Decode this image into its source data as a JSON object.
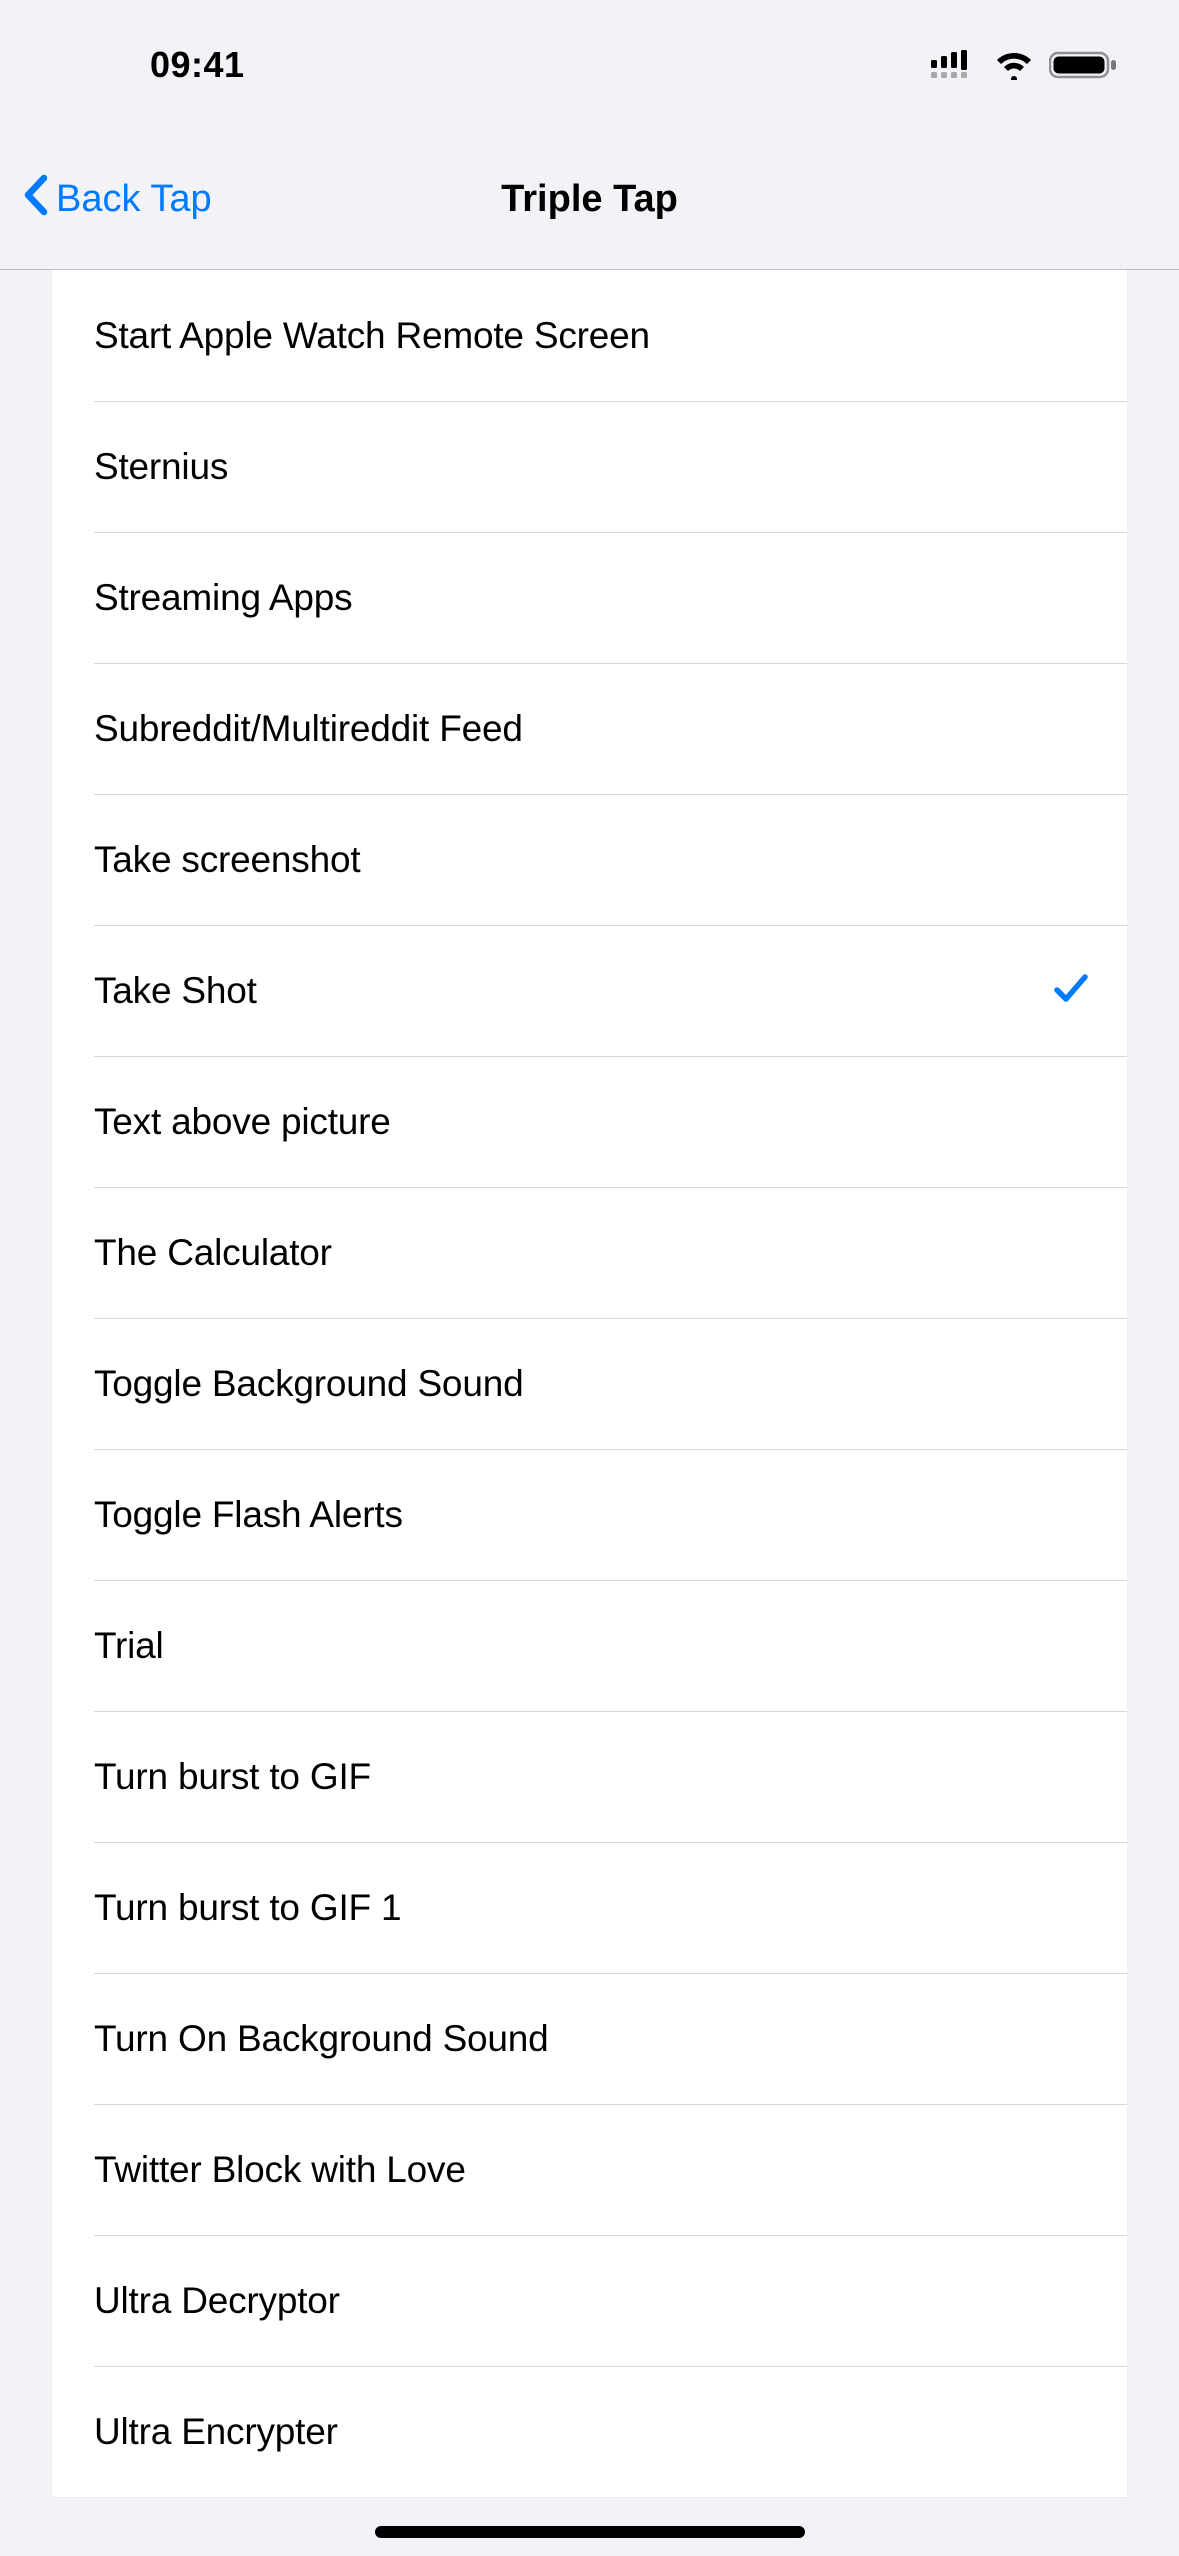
{
  "status": {
    "time": "09:41"
  },
  "nav": {
    "back_label": "Back Tap",
    "title": "Triple Tap"
  },
  "list": {
    "items": [
      {
        "label": "Start Apple Watch Remote Screen",
        "selected": false
      },
      {
        "label": "Sternius",
        "selected": false
      },
      {
        "label": "Streaming Apps",
        "selected": false
      },
      {
        "label": "Subreddit/Multireddit Feed",
        "selected": false
      },
      {
        "label": "Take screenshot",
        "selected": false
      },
      {
        "label": "Take Shot",
        "selected": true
      },
      {
        "label": "Text above picture",
        "selected": false
      },
      {
        "label": "The Calculator",
        "selected": false
      },
      {
        "label": "Toggle Background Sound",
        "selected": false
      },
      {
        "label": "Toggle Flash Alerts",
        "selected": false
      },
      {
        "label": "Trial",
        "selected": false
      },
      {
        "label": "Turn burst to GIF",
        "selected": false
      },
      {
        "label": "Turn burst to GIF 1",
        "selected": false
      },
      {
        "label": "Turn On Background Sound",
        "selected": false
      },
      {
        "label": "Twitter Block with Love",
        "selected": false
      },
      {
        "label": "Ultra Decryptor",
        "selected": false
      },
      {
        "label": "Ultra Encrypter",
        "selected": false
      }
    ]
  }
}
